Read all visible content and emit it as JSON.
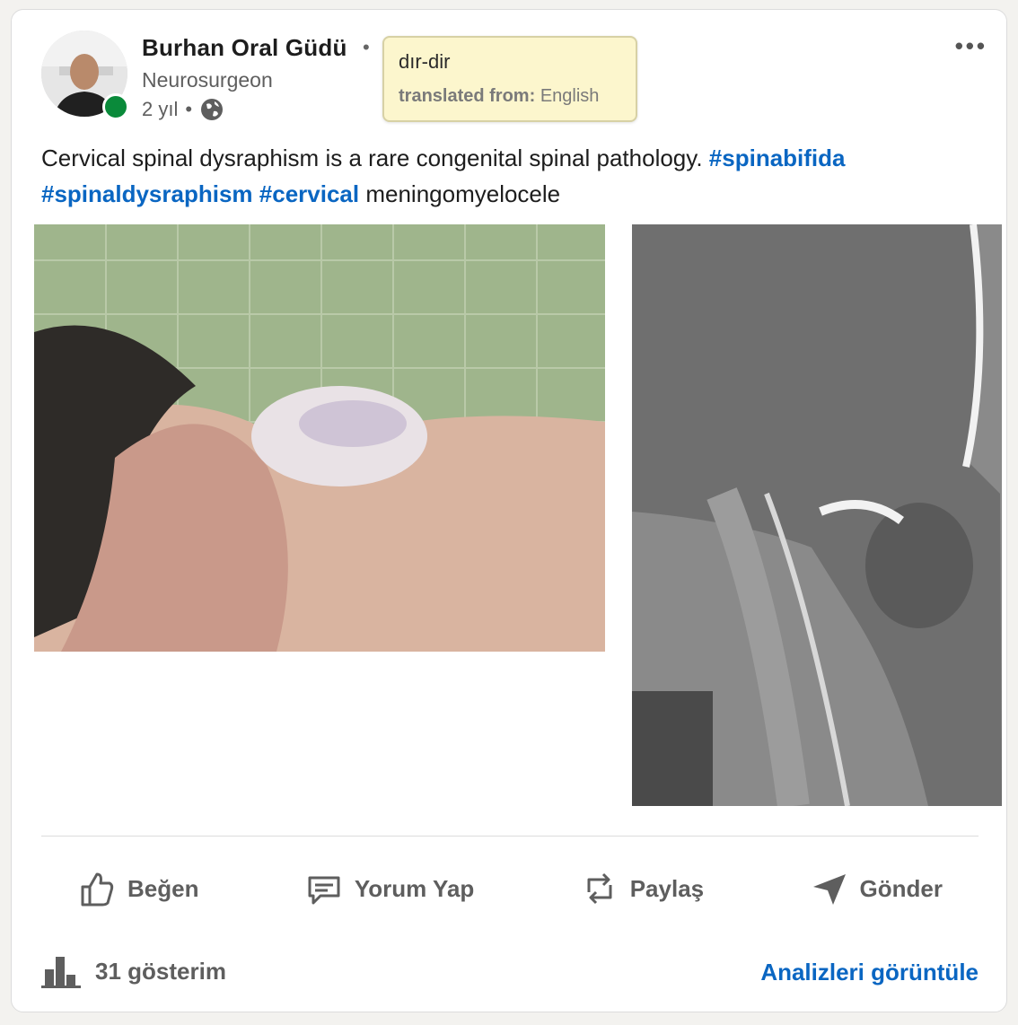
{
  "post": {
    "author": "Burhan Oral Güdü",
    "author_separator": "•",
    "headline": "Neurosurgeon",
    "age": "2 yıl",
    "age_separator": "•",
    "visibility_icon": "globe-icon",
    "more_label": "•••",
    "text": "Cervical spinal dysraphism is a rare congenital spinal pathology.",
    "hashtags": [
      "#spinabifida",
      "#spinaldysraphism",
      "#cervical"
    ],
    "text_tail": "meningomyelocele"
  },
  "tooltip": {
    "translation": "dır-dir",
    "from_label": "translated from:",
    "from_language": "English"
  },
  "actions": [
    {
      "label": "Beğen",
      "icon": "like-icon"
    },
    {
      "label": "Yorum Yap",
      "icon": "comment-icon"
    },
    {
      "label": "Paylaş",
      "icon": "repost-icon"
    },
    {
      "label": "Gönder",
      "icon": "send-icon"
    }
  ],
  "stats": {
    "impressions": "31 gösterim",
    "analytics_link": "Analizleri görüntüle"
  },
  "colors": {
    "link": "#0a66c2",
    "presence": "#0a8a3a",
    "tooltip_bg": "#fcf6cd"
  }
}
